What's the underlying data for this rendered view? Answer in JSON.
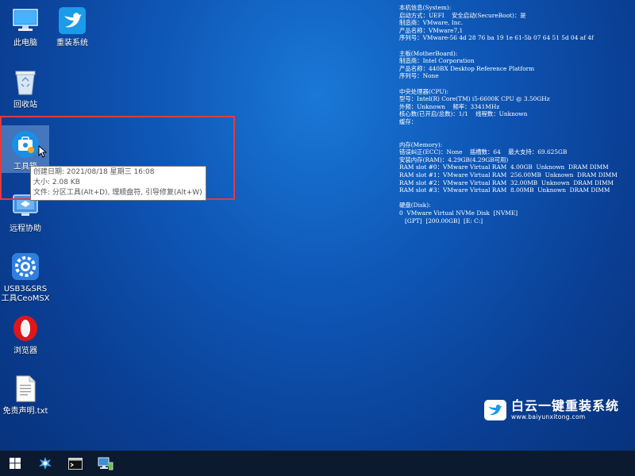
{
  "desktop": {
    "icons": [
      {
        "label": "此电脑",
        "icon": "computer-icon"
      },
      {
        "label": "重装系统",
        "icon": "bird-app-icon"
      },
      {
        "label": "回收站",
        "icon": "recycle-bin-icon"
      },
      {
        "label": "工具箱",
        "icon": "toolbox-icon"
      },
      {
        "label": "远程协助",
        "icon": "remote-assist-icon"
      },
      {
        "label": "USB3&SRS",
        "label2": "工具CeoMSX",
        "icon": "gear-app-icon"
      },
      {
        "label": "浏览器",
        "icon": "opera-icon"
      },
      {
        "label": "免责声明.txt",
        "icon": "text-file-icon"
      }
    ],
    "tooltip": {
      "created": "创建日期: 2021/08/18 星期三 16:08",
      "size": "大小: 2.08 KB",
      "file": "文件: 分区工具(Alt+D), 理顺盘符, 引导修复(Alt+W)"
    }
  },
  "sysinfo": {
    "lines": [
      "本机信息(System):",
      "启动方式：UEFI    安全启动(SecureBoot)：是",
      "制造商：VMware, Inc.",
      "产品名称：VMware7,1",
      "序列号：VMware-56 4d 28 76 ba 19 1e 61-5b 07 64 51 5d 04 af 4f",
      "",
      "主板(MotherBoard):",
      "制造商：Intel Corporation",
      "产品名称：440BX Desktop Reference Platform",
      "序列号：None",
      "",
      "中央处理器(CPU):",
      "型号：Intel(R) Core(TM) i5-6600K CPU @ 3.50GHz",
      "外频：Unknown    频率：3341MHz",
      "核心数(已开启/总数)：1/1    线程数：Unknown",
      "缓存：",
      "",
      "",
      "内存(Memory):",
      "错误纠正(ECC)：None    插槽数：64    最大支持：69.625GB",
      "安装内存(RAM)：4.29GB(4.29GB可用)",
      "RAM slot #0：VMware Virtual RAM  4.00GB  Unknown  DRAM DIMM",
      "RAM slot #1：VMware Virtual RAM  256.00MB  Unknown  DRAM DIMM",
      "RAM slot #2：VMware Virtual RAM  32.00MB  Unknown  DRAM DIMM",
      "RAM slot #3：VMware Virtual RAM  8.00MB  Unknown  DRAM DIMM",
      "",
      "硬盘(Disk):",
      "0  VMware Virtual NVMe Disk  [NVME]",
      "   [GPT]  [200.00GB]  [E: C:]"
    ]
  },
  "brand": {
    "title": "白云一键重装系统",
    "url": "www.baiyunxitong.com"
  },
  "taskbar": {
    "items": [
      "windows-start-icon",
      "app-icon",
      "terminal-icon",
      "network-icon"
    ]
  },
  "colors": {
    "desktop_blue": "#0f58b8",
    "taskbar": "#0c1a30",
    "highlight_red": "#e23b3b"
  }
}
